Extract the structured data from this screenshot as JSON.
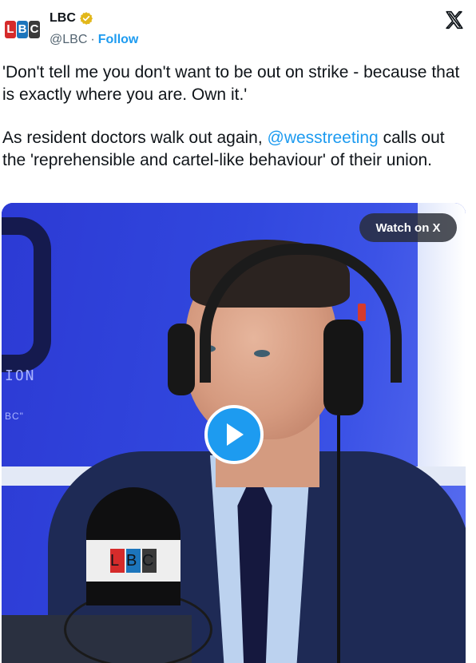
{
  "author": {
    "name": "LBC",
    "handle": "@LBC",
    "separator": "·",
    "follow_label": "Follow",
    "avatar_letters": [
      "L",
      "B",
      "C"
    ],
    "verified_badge": "verified-badge-icon"
  },
  "header": {
    "platform_icon": "x-logo-icon"
  },
  "tweet": {
    "line1": "'Don't tell me you don't want to be out on strike - because that is exactly where you are. Own it.'",
    "line2_before": "As resident doctors walk out again, ",
    "mention": "@wesstreeting",
    "line2_after": " calls out the 'reprehensible and cartel-like behaviour' of their union."
  },
  "media": {
    "watch_label": "Watch on X",
    "play_icon": "play-icon",
    "background_text_1": "ION",
    "background_text_2": "BC\"",
    "mic_logo_letters": [
      "L",
      "B",
      "C"
    ]
  },
  "colors": {
    "link": "#1d9bf0",
    "text": "#0f1419",
    "secondary": "#536471",
    "lbc_red": "#d52b2b",
    "lbc_blue": "#1c75bc",
    "lbc_dark": "#3a3a3a"
  }
}
